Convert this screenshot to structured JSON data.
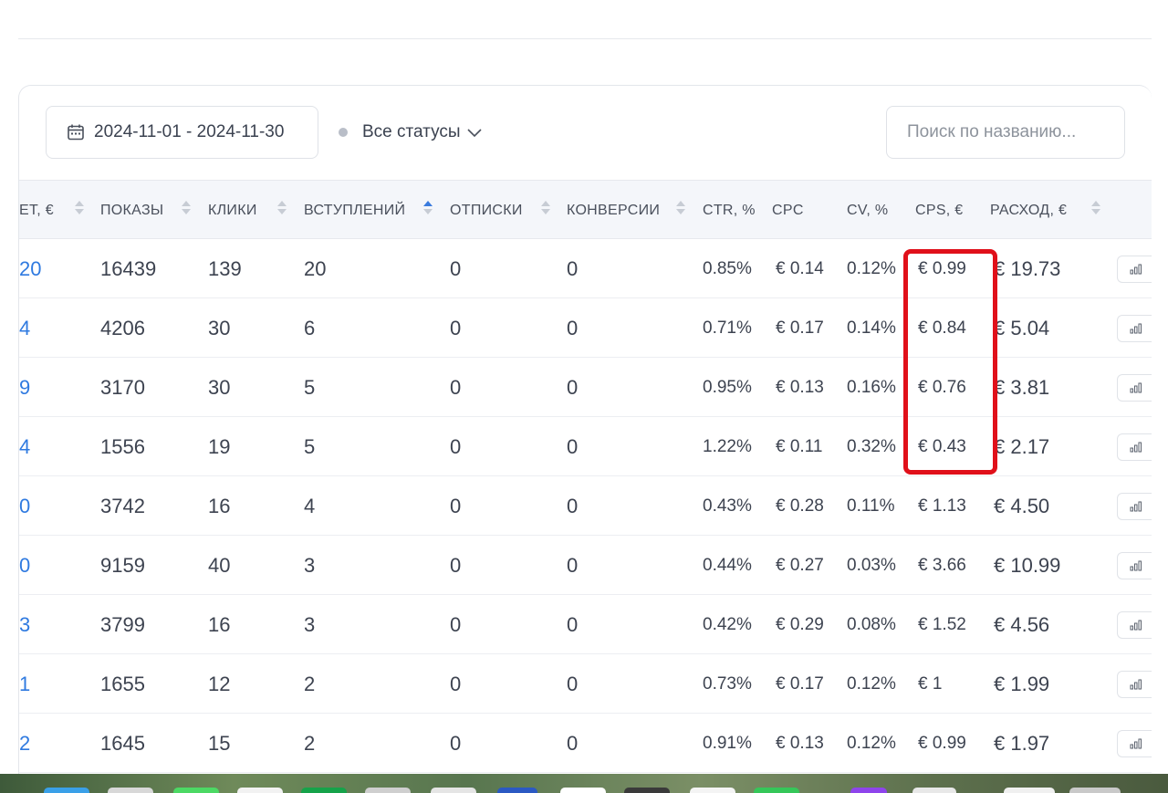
{
  "toolbar": {
    "date_range": "2024-11-01 - 2024-11-30",
    "status_filter": "Все статусы",
    "search_placeholder": "Поиск по названию..."
  },
  "columns": {
    "budget": "ЕТ, €",
    "impressions": "ПОКАЗЫ",
    "clicks": "КЛИКИ",
    "joins": "ВСТУПЛЕНИЙ",
    "unsubs": "ОТПИСКИ",
    "conversions": "КОНВЕРСИИ",
    "ctr": "CTR, %",
    "cpc": "CPC",
    "cv": "CV, %",
    "cps": "CPS, €",
    "spend": "РАСХОД, €"
  },
  "rows": [
    {
      "budget": "20",
      "impressions": "16439",
      "clicks": "139",
      "joins": "20",
      "unsubs": "0",
      "conversions": "0",
      "ctr": "0.85%",
      "cpc": "€  0.14",
      "cv": "0.12%",
      "cps": "€  0.99",
      "spend": "€ 19.73"
    },
    {
      "budget": "4",
      "impressions": "4206",
      "clicks": "30",
      "joins": "6",
      "unsubs": "0",
      "conversions": "0",
      "ctr": "0.71%",
      "cpc": "€  0.17",
      "cv": "0.14%",
      "cps": "€  0.84",
      "spend": "€ 5.04"
    },
    {
      "budget": "9",
      "impressions": "3170",
      "clicks": "30",
      "joins": "5",
      "unsubs": "0",
      "conversions": "0",
      "ctr": "0.95%",
      "cpc": "€  0.13",
      "cv": "0.16%",
      "cps": "€  0.76",
      "spend": "€ 3.81"
    },
    {
      "budget": "4",
      "impressions": "1556",
      "clicks": "19",
      "joins": "5",
      "unsubs": "0",
      "conversions": "0",
      "ctr": "1.22%",
      "cpc": "€  0.11",
      "cv": "0.32%",
      "cps": "€  0.43",
      "spend": "€ 2.17"
    },
    {
      "budget": "0",
      "impressions": "3742",
      "clicks": "16",
      "joins": "4",
      "unsubs": "0",
      "conversions": "0",
      "ctr": "0.43%",
      "cpc": "€  0.28",
      "cv": "0.11%",
      "cps": "€  1.13",
      "spend": "€ 4.50"
    },
    {
      "budget": "0",
      "impressions": "9159",
      "clicks": "40",
      "joins": "3",
      "unsubs": "0",
      "conversions": "0",
      "ctr": "0.44%",
      "cpc": "€  0.27",
      "cv": "0.03%",
      "cps": "€  3.66",
      "spend": "€ 10.99"
    },
    {
      "budget": "3",
      "impressions": "3799",
      "clicks": "16",
      "joins": "3",
      "unsubs": "0",
      "conversions": "0",
      "ctr": "0.42%",
      "cpc": "€  0.29",
      "cv": "0.08%",
      "cps": "€  1.52",
      "spend": "€ 4.56"
    },
    {
      "budget": "1",
      "impressions": "1655",
      "clicks": "12",
      "joins": "2",
      "unsubs": "0",
      "conversions": "0",
      "ctr": "0.73%",
      "cpc": "€  0.17",
      "cv": "0.12%",
      "cps": "€  1",
      "spend": "€ 1.99"
    },
    {
      "budget": "2",
      "impressions": "1645",
      "clicks": "15",
      "joins": "2",
      "unsubs": "0",
      "conversions": "0",
      "ctr": "0.91%",
      "cpc": "€  0.13",
      "cv": "0.12%",
      "cps": "€  0.99",
      "spend": "€ 1.97"
    }
  ],
  "colors": {
    "accent": "#2f7ae0",
    "highlight": "#e0101a",
    "header_bg": "#f4f6fa"
  },
  "icons": {
    "date": "calendar-icon",
    "status": "chevron-down-icon",
    "row_action": "bar-chart-icon"
  }
}
